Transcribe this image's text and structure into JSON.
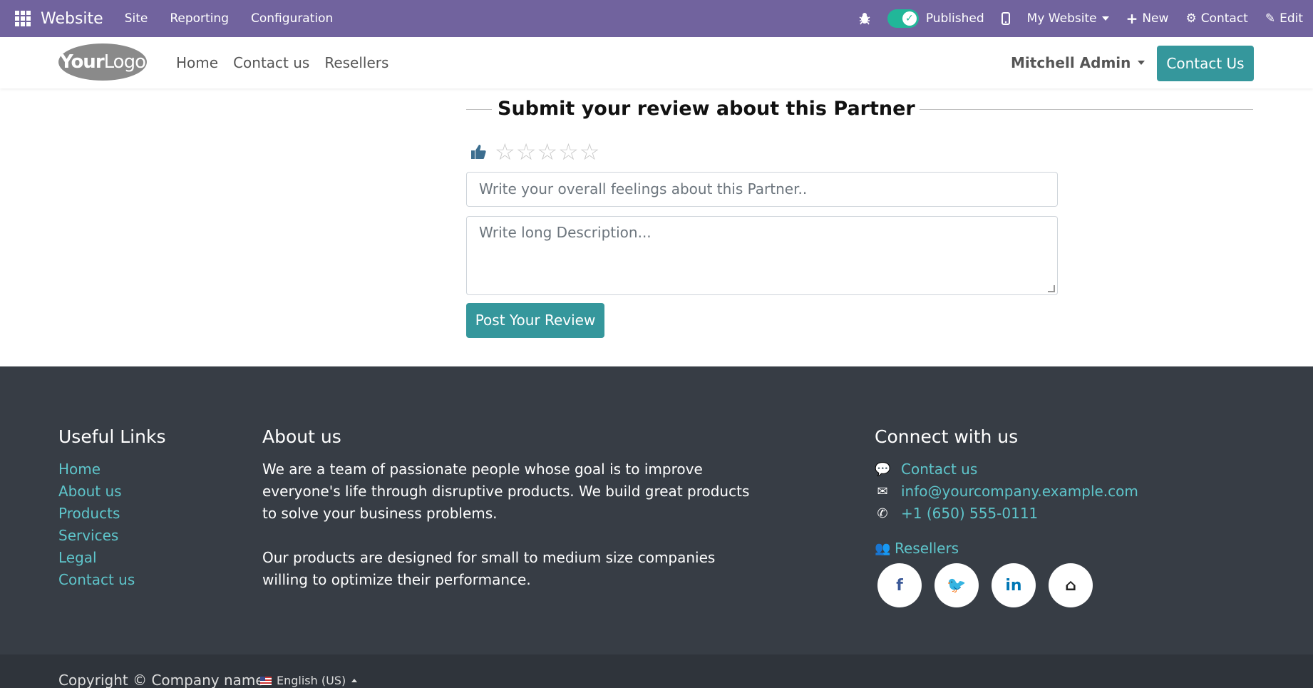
{
  "adminbar": {
    "app_name": "Website",
    "menus": [
      "Site",
      "Reporting",
      "Configuration"
    ],
    "publish_status": "Published",
    "website_selector": "My Website",
    "new_label": "New",
    "contact_label": "Contact",
    "edit_label": "Edit",
    "bg_color": "#71639e"
  },
  "header": {
    "logo_bold": "Your",
    "logo_light": "Logo",
    "nav": [
      "Home",
      "Contact us",
      "Resellers"
    ],
    "user": "Mitchell Admin",
    "cta": "Contact Us",
    "accent": "#35979c"
  },
  "review": {
    "title": "Submit your review about this Partner",
    "rating_stars": 0,
    "rating_max": 5,
    "summary_placeholder": "Write your overall feelings about this Partner..",
    "description_placeholder": "Write long Description...",
    "submit_label": "Post Your Review"
  },
  "footer": {
    "useful_links_title": "Useful Links",
    "useful_links": [
      "Home",
      "About us",
      "Products",
      "Services",
      "Legal",
      "Contact us"
    ],
    "about_title": "About us",
    "about_p1": "We are a team of passionate people whose goal is to improve everyone's life through disruptive products. We build great products to solve your business problems.",
    "about_p2": "Our products are designed for small to medium size companies willing to optimize their performance.",
    "connect_title": "Connect with us",
    "contact_link": "Contact us",
    "email": "info@yourcompany.example.com",
    "phone": "+1 (650) 555-0111",
    "resellers": "Resellers",
    "social": [
      {
        "name": "facebook",
        "glyph": "f",
        "color": "#3b5998"
      },
      {
        "name": "twitter",
        "glyph": "🐦",
        "color": "#1da1f2"
      },
      {
        "name": "linkedin",
        "glyph": "in",
        "color": "#0077b5"
      },
      {
        "name": "home",
        "glyph": "⌂",
        "color": "#222222"
      }
    ],
    "copyright": "Copyright © Company name",
    "language": "English (US)"
  }
}
